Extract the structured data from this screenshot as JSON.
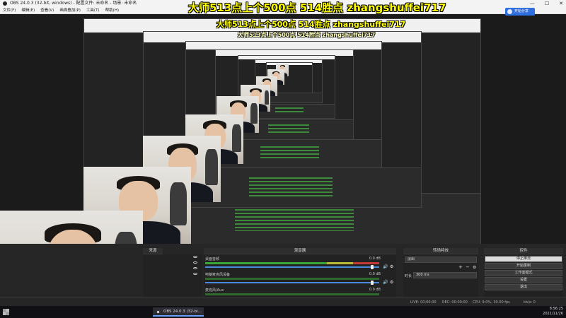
{
  "window": {
    "title": "OBS 24.0.3 (32-bit, windows) - 配置文件: 未命名 - 场景: 未命名",
    "controls": [
      "—",
      "☐",
      "✕"
    ]
  },
  "menu": [
    "文件(F)",
    "编辑(E)",
    "查看(V)",
    "画面叠加(P)",
    "工具(T)",
    "帮助(H)"
  ],
  "overlay": {
    "line1": "大师513点上个500点   514胜点   zhangshuffei717",
    "line2": "大师513点上个500点   514胜点   zhangshuffei717",
    "line3": "大师513点上个500点   514胜点   zhangshuffei717"
  },
  "share_button": "开始分享",
  "docks": {
    "sources_title": "来源",
    "mixer_title": "混音器",
    "transitions_title": "转场特效",
    "controls_title": "控件",
    "mixer_channels": [
      {
        "name": "桌面音频",
        "db": "0.0 dB"
      },
      {
        "name": "电脑麦克风设备",
        "db": "0.0 dB"
      },
      {
        "name": "麦克风/Aux",
        "db": "0.0 dB"
      }
    ],
    "transition": {
      "type": "淡出",
      "duration_label": "时长",
      "duration_value": "300 ms"
    },
    "controls": [
      "停止推流",
      "开始录制",
      "工作室模式",
      "设置",
      "退出"
    ]
  },
  "status": {
    "live": "LIVE: 00:00:00",
    "rec": "REC: 00:00:00",
    "cpu": "CPU: 9.0%, 30.00 fps",
    "kbps": "kb/s: 0"
  },
  "taskbar": {
    "app_label": "OBS 24.0.3 (32-bi...",
    "time": "8:56:25",
    "date": "2021/11/26"
  }
}
